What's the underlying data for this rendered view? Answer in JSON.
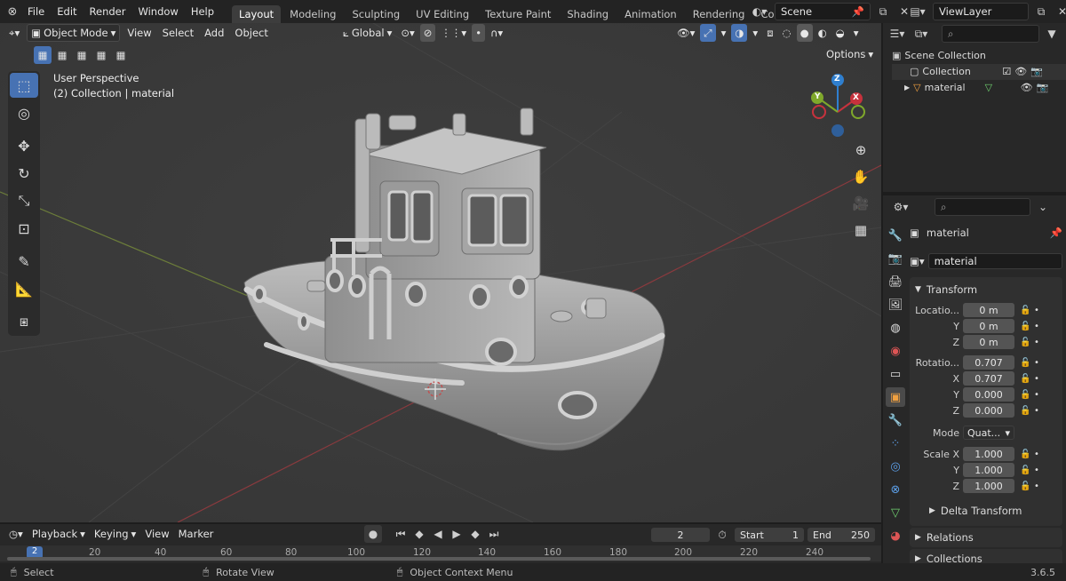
{
  "menu": [
    "File",
    "Edit",
    "Render",
    "Window",
    "Help"
  ],
  "workspaces": [
    "Layout",
    "Modeling",
    "Sculpting",
    "UV Editing",
    "Texture Paint",
    "Shading",
    "Animation",
    "Rendering",
    "Compositing"
  ],
  "scene": "Scene",
  "view_layer": "ViewLayer",
  "viewport": {
    "mode": "Object Mode",
    "menus": [
      "View",
      "Select",
      "Add",
      "Object"
    ],
    "orientation": "Global",
    "options_label": "Options",
    "info_line1": "User Perspective",
    "info_line2": "(2) Collection | material",
    "gizmo": {
      "x": "X",
      "y": "Y",
      "z": "Z"
    }
  },
  "outliner": {
    "root": "Scene Collection",
    "collection": "Collection",
    "object": "material"
  },
  "properties": {
    "object_name": "material",
    "data_name": "material",
    "transform_label": "Transform",
    "location_label": "Locatio...",
    "location": [
      "0 m",
      "0 m",
      "0 m"
    ],
    "rotation_label": "Rotatio...",
    "rotation": [
      "0.707",
      "0.707",
      "0.000",
      "0.000"
    ],
    "mode_label": "Mode",
    "mode_value": "Quat...",
    "scale_label": "Scale X",
    "scale": [
      "1.000",
      "1.000",
      "1.000"
    ],
    "axis": {
      "x": "X",
      "y": "Y",
      "z": "Z"
    },
    "delta": "Delta Transform",
    "relations": "Relations",
    "collections": "Collections"
  },
  "timeline": {
    "menus": [
      "Playback",
      "Keying",
      "View",
      "Marker"
    ],
    "current_frame": "2",
    "start_label": "Start",
    "start": "1",
    "end_label": "End",
    "end": "250",
    "ticks": [
      "2",
      "20",
      "40",
      "60",
      "80",
      "100",
      "120",
      "140",
      "160",
      "180",
      "200",
      "220",
      "240"
    ]
  },
  "status": {
    "select": "Select",
    "rotate": "Rotate View",
    "context": "Object Context Menu",
    "version": "3.6.5"
  },
  "colors": {
    "accent": "#4772b3",
    "bg": "#393939",
    "panel": "#282828",
    "x_axis": "#c7323d",
    "y_axis": "#7fa82b",
    "z_axis": "#2f7fcf"
  }
}
